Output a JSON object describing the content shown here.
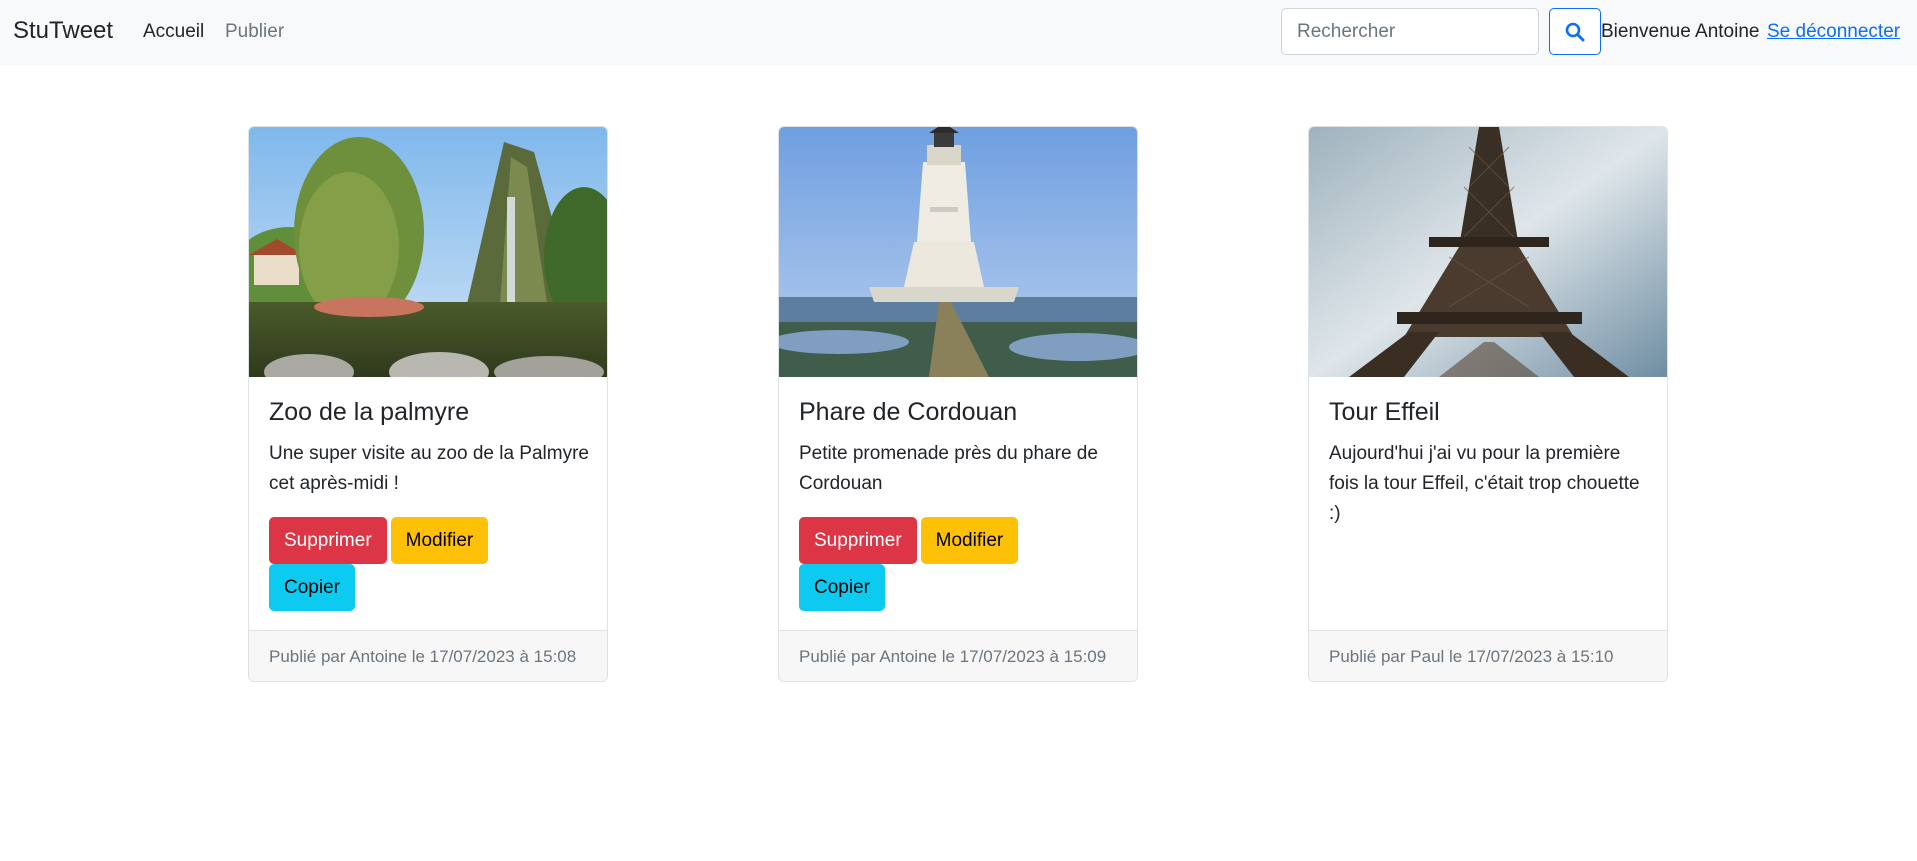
{
  "navbar": {
    "brand": "StuTweet",
    "links": {
      "home": "Accueil",
      "publish": "Publier"
    },
    "search": {
      "placeholder": "Rechercher",
      "value": ""
    },
    "welcome": "Bienvenue Antoine",
    "logout": "Se déconnecter"
  },
  "posts": [
    {
      "title": "Zoo de la palmyre",
      "text": "Une super visite au zoo de la Palmyre cet après-midi !",
      "image": "zoo-waterfall-flamingos-photo",
      "buttons": {
        "delete": "Supprimer",
        "edit": "Modifier",
        "copy": "Copier"
      },
      "footer": "Publié par Antoine le 17/07/2023 à 15:08"
    },
    {
      "title": "Phare de Cordouan",
      "text": "Petite promenade près du phare de Cordouan",
      "image": "lighthouse-photo",
      "buttons": {
        "delete": "Supprimer",
        "edit": "Modifier",
        "copy": "Copier"
      },
      "footer": "Publié par Antoine le 17/07/2023 à 15:09"
    },
    {
      "title": "Tour Effeil",
      "text": "Aujourd'hui j'ai vu pour la première fois la tour Effeil, c'était trop chouette :)",
      "image": "eiffel-tower-photo",
      "footer": "Publié par Paul le 17/07/2023 à 15:10"
    }
  ],
  "colors": {
    "navbar_bg": "#f8f9fa",
    "primary": "#0d6efd",
    "danger": "#dc3545",
    "warning": "#ffc107",
    "info": "#0dcaf0",
    "muted": "#6c757d"
  },
  "icons": {
    "search": "search-icon"
  }
}
